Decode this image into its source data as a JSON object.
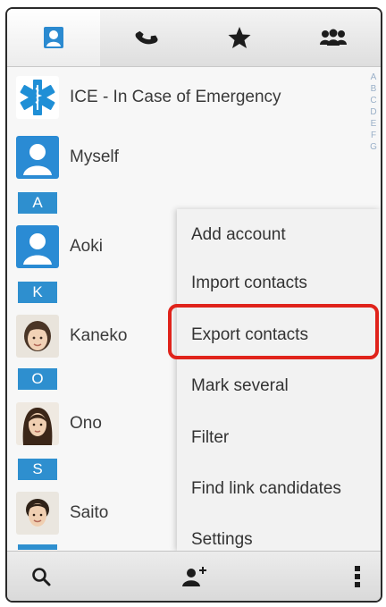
{
  "tabs": [
    {
      "icon": "contacts-icon"
    },
    {
      "icon": "phone-icon"
    },
    {
      "icon": "star-icon"
    },
    {
      "icon": "groups-icon"
    }
  ],
  "contacts": {
    "ice": {
      "name": "ICE - In Case of Emergency",
      "icon": "ice-star-of-life-icon"
    },
    "myself": {
      "name": "Myself"
    },
    "aoki": {
      "name": "Aoki",
      "section": "A"
    },
    "kaneko": {
      "name": "Kaneko",
      "section": "K"
    },
    "ono": {
      "name": "Ono",
      "section": "O"
    },
    "saito": {
      "name": "Saito",
      "section": "S"
    }
  },
  "index_letters": [
    "A",
    "B",
    "C",
    "D",
    "E",
    "F",
    "G"
  ],
  "menu": {
    "items": [
      "Add account",
      "Import contacts",
      "Export contacts",
      "Mark several",
      "Filter",
      "Find link candidates",
      "Settings"
    ],
    "highlighted": "Export contacts",
    "highlight_color": "#e0231b"
  },
  "bottom_bar": {
    "left_icon": "search-icon",
    "center_icon": "add-contact-icon",
    "right_icon": "more-vert-icon"
  },
  "colors": {
    "accent": "#2e8fcf"
  }
}
